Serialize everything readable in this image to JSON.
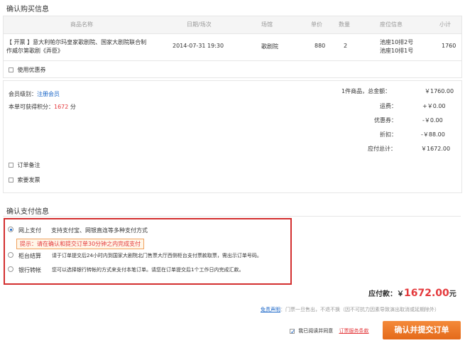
{
  "purchase": {
    "section_title": "确认购买信息",
    "columns": [
      "商品名称",
      "日期/场次",
      "场馆",
      "单价",
      "数量",
      "座位信息",
      "小计"
    ],
    "item": {
      "name_line1": "【 开票 】意大利帕尔玛皇家歌剧院、国家大剧院联合制",
      "name_line2": "作威尔第歌剧《弄臣》",
      "date": "2014-07-31 19:30",
      "venue": "歌剧院",
      "price": "880",
      "qty": "2",
      "seat1": "池座10排2号",
      "seat2": "池座10排1号",
      "subtotal": "1760"
    },
    "coupon_label": "使用优惠券"
  },
  "summary": {
    "member_level_label": "会员级别：",
    "member_level_value": "注册会员",
    "points_label": "本单可获得积分：",
    "points_value": "1672",
    "points_unit": "分",
    "total_label": "1件商品，总金额：",
    "total_value": "￥1760.00",
    "shipping_label": "运费：",
    "shipping_value": "+￥0.00",
    "discount_label": "优惠券：",
    "discount_value": "-￥0.00",
    "rebate_label": "折扣：",
    "rebate_value": "-￥88.00",
    "payable_label": "应付总计：",
    "payable_value": "￥1672.00",
    "order_note_label": "订单备注",
    "invoice_label": "索要发票"
  },
  "payment": {
    "section_title": "确认支付信息",
    "options": [
      {
        "name": "网上支付",
        "desc": "支持支付宝、网银直连等多种支付方式"
      },
      {
        "name": "柜台结算",
        "desc": "请于订单提交后24小时内到国家大剧院北门售票大厅西侧柜台支付票款取票，需出示订单号码。"
      },
      {
        "name": "银行转帐",
        "desc": "您可以选择银行转帐的方式来支付本笔订单。请您在订单提交后1个工作日内完成汇款。"
      }
    ],
    "tip": "提示：请在确认和提交订单30分钟之内完成支付"
  },
  "footer": {
    "due_label": "应付款：",
    "currency": "￥",
    "due_amount": "1672.00",
    "due_unit": "元",
    "disclaimer_link": "免责声明",
    "disclaimer_text": "：门票一旦售出，不退不换（因不可抗力因素导致演出取消或延期除外）",
    "agree_text": "我已阅读并同意",
    "terms_link": "订票服务条款",
    "submit_label": "确认并提交订单",
    "colors": {
      "accent": "#e4393c",
      "button": "#ee7a2a",
      "link": "#1a66c7"
    }
  }
}
